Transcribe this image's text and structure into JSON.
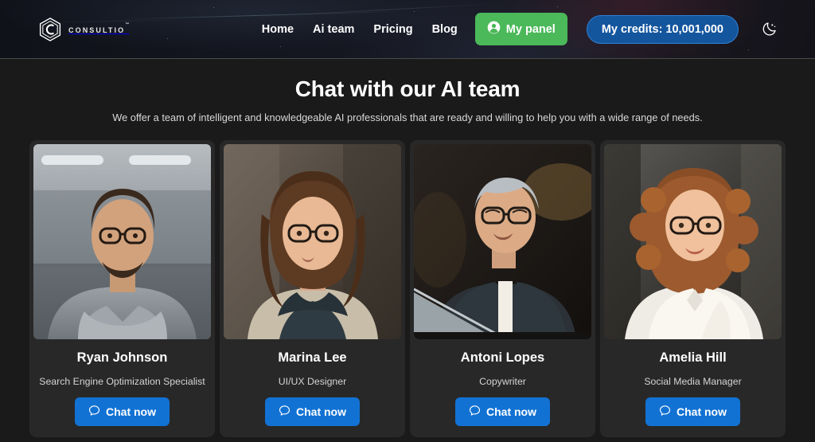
{
  "header": {
    "logo": {
      "icon": "hexagon-c-logo-icon",
      "text": "CONSULTIO",
      "trademark": "™"
    },
    "nav": [
      {
        "label": "Home",
        "name": "nav-link-home"
      },
      {
        "label": "Ai team",
        "name": "nav-link-ai-team"
      },
      {
        "label": "Pricing",
        "name": "nav-link-pricing"
      },
      {
        "label": "Blog",
        "name": "nav-link-blog"
      }
    ],
    "panel_button": {
      "label": "My panel",
      "icon": "user-circle-icon",
      "color": "#4bb859"
    },
    "credits_button": {
      "label": "My credits: 10,001,000",
      "color": "#14569e"
    },
    "theme_toggle": {
      "icon": "crescent-moon-icon"
    }
  },
  "main": {
    "title": "Chat with our AI team",
    "subtitle": "We offer a team of intelligent and knowledgeable AI professionals that are ready and willing to help you with a wide range of needs.",
    "chat_button_label": "Chat now",
    "chat_button_icon": "chat-bubble-icon",
    "cards": [
      {
        "name": "Ryan Johnson",
        "role": "Search Engine Optimization Specialist",
        "photo_alt": "bearded-man-with-glasses-arms-crossed-in-office"
      },
      {
        "name": "Marina Lee",
        "role": "UI/UX Designer",
        "photo_alt": "woman-with-glasses-and-long-brown-hair"
      },
      {
        "name": "Antoni Lopes",
        "role": "Copywriter",
        "photo_alt": "man-with-glasses-smiling-at-laptop"
      },
      {
        "name": "Amelia Hill",
        "role": "Social Media Manager",
        "photo_alt": "woman-with-curly-red-hair-and-glasses"
      }
    ]
  },
  "colors": {
    "page_background": "#1a1a1a",
    "card_background": "#282828",
    "accent_blue": "#1272d4",
    "accent_green": "#4bb859",
    "credits_blue": "#14569e"
  }
}
